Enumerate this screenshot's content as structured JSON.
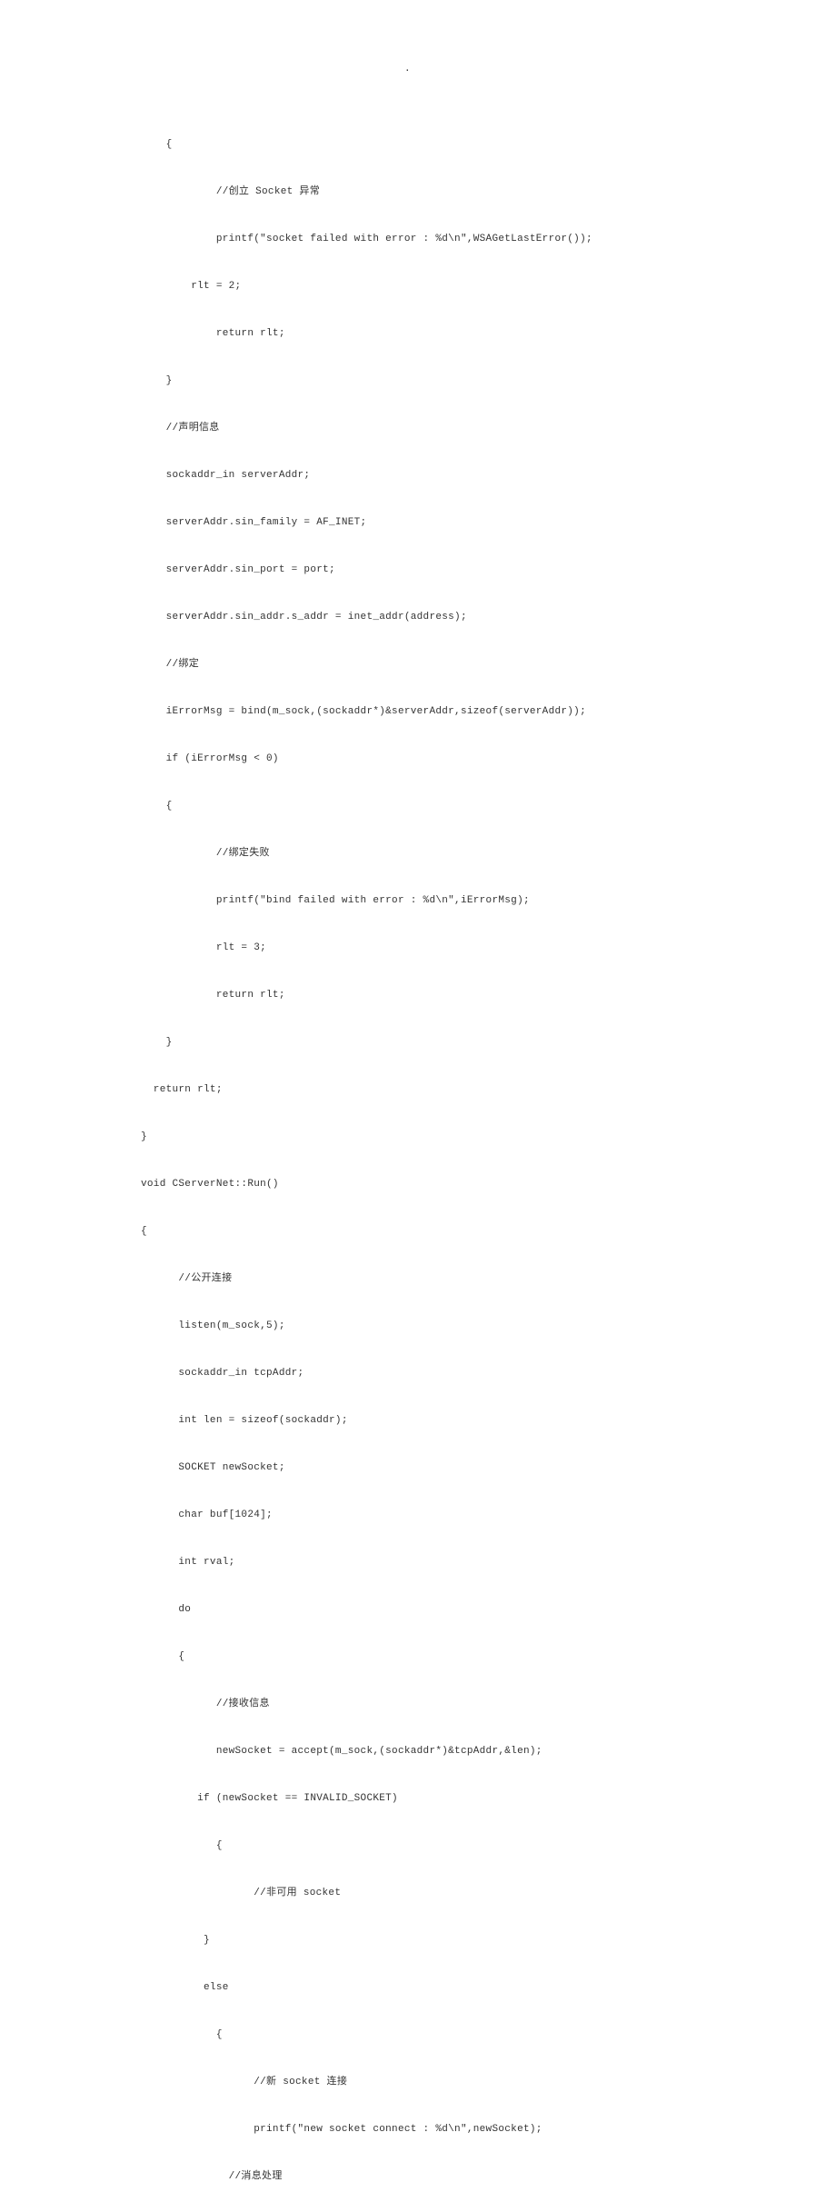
{
  "pageDot": ".",
  "code": {
    "lines": [
      "    {",
      "            //创立 Socket 异常",
      "            printf(\"socket failed with error : %d\\n\",WSAGetLastError());",
      "        rlt = 2;",
      "            return rlt;",
      "    }",
      "    //声明信息",
      "    sockaddr_in serverAddr;",
      "    serverAddr.sin_family = AF_INET;",
      "    serverAddr.sin_port = port;",
      "    serverAddr.sin_addr.s_addr = inet_addr(address);",
      "    //绑定",
      "    iErrorMsg = bind(m_sock,(sockaddr*)&serverAddr,sizeof(serverAddr));",
      "    if (iErrorMsg < 0)",
      "    {",
      "            //绑定失败",
      "            printf(\"bind failed with error : %d\\n\",iErrorMsg);",
      "            rlt = 3;",
      "            return rlt;",
      "    }",
      "  return rlt;",
      "}",
      "void CServerNet::Run()",
      "{",
      "      //公开连接",
      "      listen(m_sock,5);",
      "      sockaddr_in tcpAddr;",
      "      int len = sizeof(sockaddr);",
      "      SOCKET newSocket;",
      "      char buf[1024];",
      "      int rval;",
      "      do",
      "      {",
      "            //接收信息",
      "            newSocket = accept(m_sock,(sockaddr*)&tcpAddr,&len);",
      "         if (newSocket == INVALID_SOCKET)",
      "            {",
      "                  //非可用 socket",
      "          }",
      "          else",
      "            {",
      "                  //新 socket 连接",
      "                  printf(\"new socket connect : %d\\n\",newSocket);",
      "              //消息处理"
    ]
  }
}
